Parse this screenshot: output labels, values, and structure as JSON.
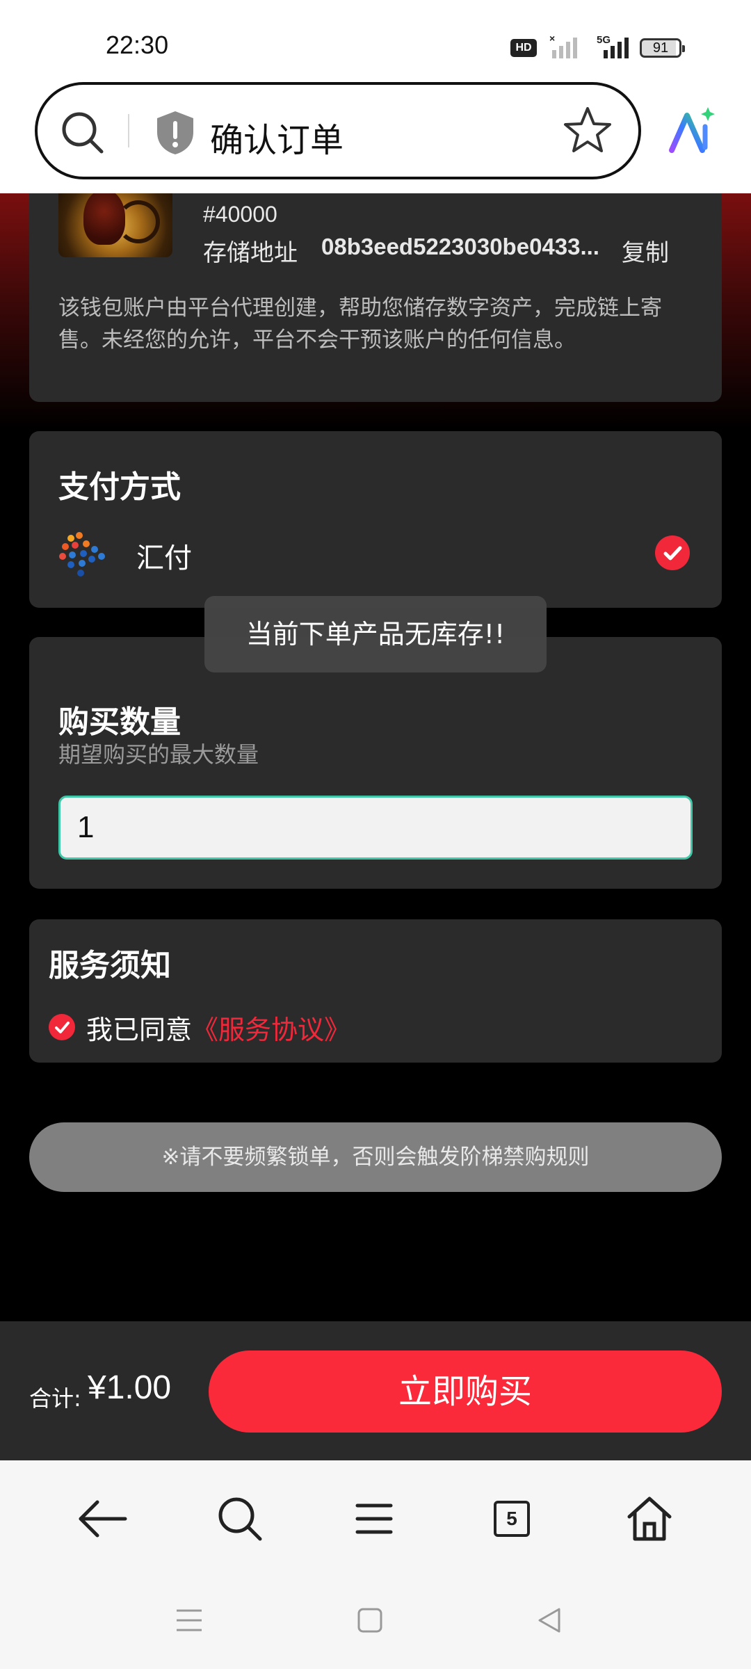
{
  "status_bar": {
    "time": "22:30",
    "network": "5G",
    "hd_label": "HD",
    "battery": "91"
  },
  "browser": {
    "page_title": "确认订单",
    "tab_count": "5"
  },
  "wallet": {
    "token_id": "#40000",
    "address_label": "存储地址",
    "address_value": "08b3eed5223030be0433...",
    "copy_label": "复制",
    "description": "该钱包账户由平台代理创建，帮助您储存数字资产，完成链上寄售。未经您的允许，平台不会干预该账户的任何信息。"
  },
  "payment": {
    "title": "支付方式",
    "method_name": "汇付",
    "selected": true
  },
  "quantity": {
    "title": "购买数量",
    "subtitle": "期望购买的最大数量",
    "value": "1"
  },
  "toast": {
    "message": "当前下单产品无库存!!"
  },
  "service": {
    "title": "服务须知",
    "agree_text": "我已同意",
    "agreement_link": "《服务协议》",
    "agreed": true
  },
  "notice": {
    "text": "※请不要频繁锁单，否则会触发阶梯禁购规则"
  },
  "order": {
    "total_label": "合计:",
    "total_value": "¥1.00",
    "buy_label": "立即购买"
  },
  "colors": {
    "accent": "#fb2a3b",
    "input_border": "#3fc7a8",
    "card": "#2b2b2b"
  }
}
